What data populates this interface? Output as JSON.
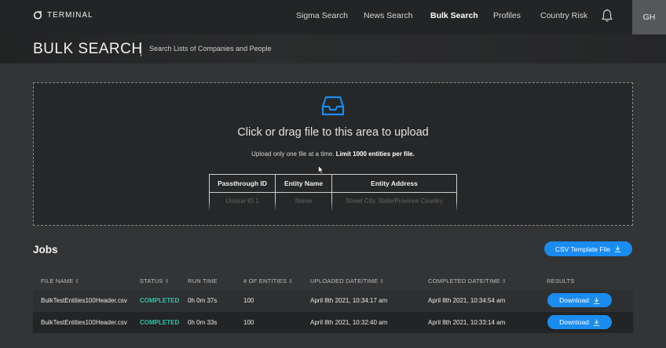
{
  "nav": {
    "logo": "TERMINAL",
    "items": [
      {
        "label": "Sigma Search",
        "active": false
      },
      {
        "label": "News Search",
        "active": false
      },
      {
        "label": "Bulk Search",
        "active": true
      },
      {
        "label": "Profiles",
        "active": false
      },
      {
        "label": "Country Risk",
        "active": false
      }
    ],
    "bell_icon": "bell-icon",
    "avatar_initials": "GH"
  },
  "banner": {
    "title": "BULK SEARCH",
    "subtitle": "Search Lists of Companies and People"
  },
  "upload": {
    "icon": "inbox-icon",
    "title": "Click or drag file to this area to upload",
    "hint_prefix": "Upload only one file at a time.",
    "hint_bold": "Limit 1000 entities per file.",
    "sample_columns": [
      "Passthrough ID",
      "Entity Name",
      "Entity Address"
    ],
    "sample_values": [
      "Unique ID 1",
      "Name",
      "Street City, State/Province Country"
    ]
  },
  "jobs": {
    "title": "Jobs",
    "template_button": "CSV Template File",
    "columns": [
      "FILE NAME",
      "STATUS",
      "RUN TIME",
      "# OF ENTITIES",
      "UPLOADED DATE/TIME",
      "COMPLETED DATE/TIME",
      "RESULTS"
    ],
    "rows": [
      {
        "file_name": "BulkTestEntities100Header.csv",
        "status": "COMPLETED",
        "run_time": "0h 0m 37s",
        "entities": "100",
        "uploaded": "April 8th 2021, 10:34:17 am",
        "completed": "April 8th 2021, 10:34:54 am",
        "result_button": "Download"
      },
      {
        "file_name": "BulkTestEntities100Header.csv",
        "status": "COMPLETED",
        "run_time": "0h 0m 33s",
        "entities": "100",
        "uploaded": "April 8th 2021, 10:32:40 am",
        "completed": "April 8th 2021, 10:33:14 am",
        "result_button": "Download"
      }
    ]
  },
  "colors": {
    "accent": "#1a8cf0",
    "status_completed": "#2bc4a5",
    "nav_bg": "#232425",
    "page_bg": "#333435"
  }
}
